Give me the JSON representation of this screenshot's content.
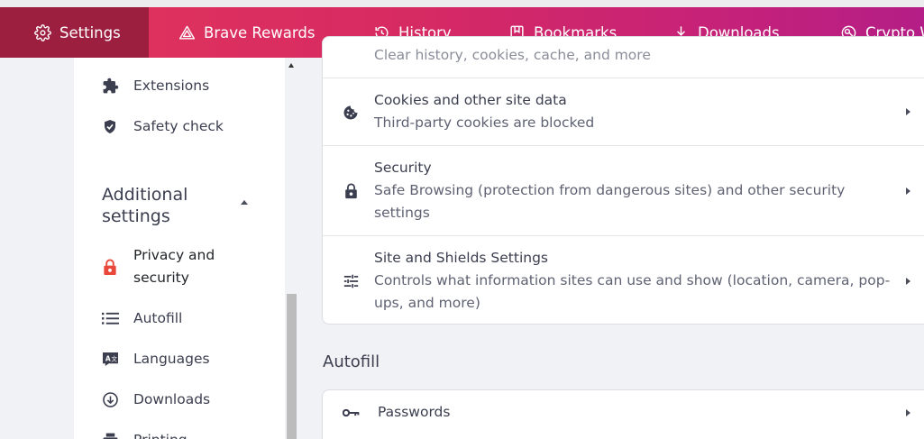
{
  "tabs": [
    {
      "label": "Settings",
      "icon": "gear-icon",
      "active": true
    },
    {
      "label": "Brave Rewards",
      "icon": "rewards-triangle-icon",
      "active": false
    },
    {
      "label": "History",
      "icon": "history-clock-icon",
      "active": false
    },
    {
      "label": "Bookmarks",
      "icon": "bookmark-icon",
      "active": false
    },
    {
      "label": "Downloads",
      "icon": "download-icon",
      "active": false
    },
    {
      "label": "Crypto W",
      "icon": "wallet-icon",
      "active": false
    }
  ],
  "sidebar": {
    "items_top": [
      {
        "label": "Extensions",
        "icon": "puzzle-piece-icon"
      },
      {
        "label": "Safety check",
        "icon": "shield-check-icon"
      }
    ],
    "section_label_line1": "Additional",
    "section_label_line2": "settings",
    "items_additional": [
      {
        "label_line1": "Privacy and",
        "label_line2": "security",
        "icon": "lock-icon",
        "active": true
      },
      {
        "label": "Autofill",
        "icon": "list-icon"
      },
      {
        "label": "Languages",
        "icon": "translate-icon"
      },
      {
        "label": "Downloads",
        "icon": "download-circle-icon"
      },
      {
        "label": "Printing",
        "icon": "printer-icon"
      }
    ]
  },
  "privacy_card": {
    "partial_row": "Clear history, cookies, cache, and more",
    "rows": [
      {
        "title": "Cookies and other site data",
        "sub": [
          "Third-party cookies are blocked"
        ],
        "icon": "cookie-icon"
      },
      {
        "title": "Security",
        "sub": [
          "Safe Browsing (protection from dangerous sites) and other security",
          "settings"
        ],
        "icon": "padlock-icon"
      },
      {
        "title": "Site and Shields Settings",
        "sub": [
          "Controls what information sites can use and show (location, camera, pop-",
          "ups, and more)"
        ],
        "icon": "tune-sliders-icon"
      }
    ]
  },
  "autofill": {
    "section_title": "Autofill",
    "rows": [
      {
        "title": "Passwords",
        "icon": "key-icon"
      }
    ]
  },
  "colors": {
    "tab_gradient_start": "#e2355b",
    "tab_gradient_end": "#b41e86",
    "active_tab": "#9c1f3f",
    "active_nav_icon": "#e8473a"
  }
}
